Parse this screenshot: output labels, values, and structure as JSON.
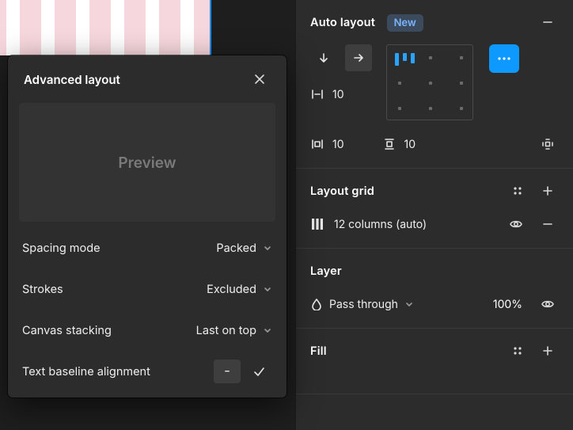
{
  "advanced_layout": {
    "title": "Advanced layout",
    "preview_label": "Preview",
    "rows": {
      "spacing_mode": {
        "label": "Spacing mode",
        "value": "Packed"
      },
      "strokes": {
        "label": "Strokes",
        "value": "Excluded"
      },
      "canvas_stacking": {
        "label": "Canvas stacking",
        "value": "Last on top"
      },
      "text_baseline": {
        "label": "Text baseline alignment",
        "active_option": "-"
      }
    }
  },
  "sidebar": {
    "auto_layout": {
      "title": "Auto layout",
      "badge": "New",
      "direction": "horizontal",
      "gap": "10",
      "padding_h": "10",
      "padding_v": "10",
      "alignment": "top-left"
    },
    "layout_grid": {
      "title": "Layout grid",
      "items": [
        {
          "label": "12 columns (auto)"
        }
      ]
    },
    "layer": {
      "title": "Layer",
      "blend_mode": "Pass through",
      "opacity": "100%"
    },
    "fill": {
      "title": "Fill"
    }
  }
}
